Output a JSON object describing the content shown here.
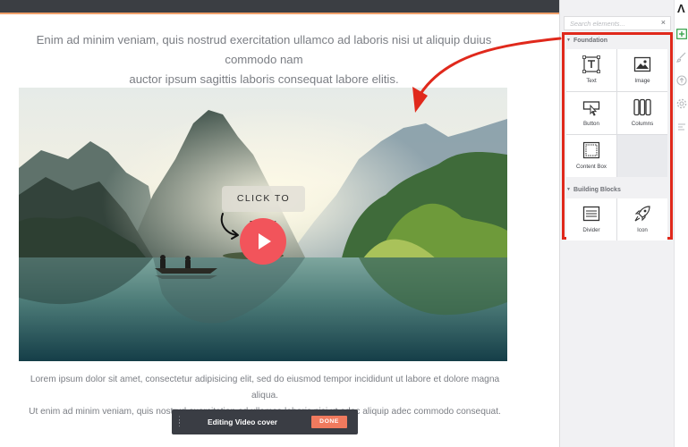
{
  "canvas": {
    "lead_line1": "Enim ad minim veniam, quis nostrud exercitation ullamco ad laboris nisi ut aliquip duius commodo nam",
    "lead_line2": "auctor ipsum sagittis laboris consequat labore elitis.",
    "body_line1": "Lorem ipsum dolor sit amet, consectetur adipisicing elit, sed do eiusmod tempor incididunt ut labore et dolore magna aliqua.",
    "body_line2": "Ut enim ad minim veniam, quis nostrud exercitation ad ullamco laboris nisi ut adec aliquip adec commodo consequat."
  },
  "video": {
    "cta_label": "CLICK TO PLAY",
    "play_icon": "play-icon",
    "accent_color": "#f2545b"
  },
  "edit_bar": {
    "label": "Editing Video cover",
    "done_label": "DONE",
    "done_color": "#f07a5e"
  },
  "panel": {
    "search_placeholder": "Search elements...",
    "close_glyph": "×",
    "sections": [
      {
        "title": "Foundation",
        "items": [
          {
            "label": "Text",
            "icon": "text-icon"
          },
          {
            "label": "Image",
            "icon": "image-icon"
          },
          {
            "label": "Button",
            "icon": "button-icon"
          },
          {
            "label": "Columns",
            "icon": "columns-icon"
          },
          {
            "label": "Content Box",
            "icon": "content-box-icon"
          }
        ]
      },
      {
        "title": "Building Blocks",
        "items": [
          {
            "label": "Divider",
            "icon": "divider-icon"
          },
          {
            "label": "Icon",
            "icon": "rocket-icon"
          }
        ]
      }
    ],
    "highlight_color": "#e0291c"
  },
  "rail": {
    "icons": [
      "brand-logo",
      "add-element-icon",
      "brush-icon",
      "upload-icon",
      "settings-icon",
      "history-icon"
    ]
  }
}
